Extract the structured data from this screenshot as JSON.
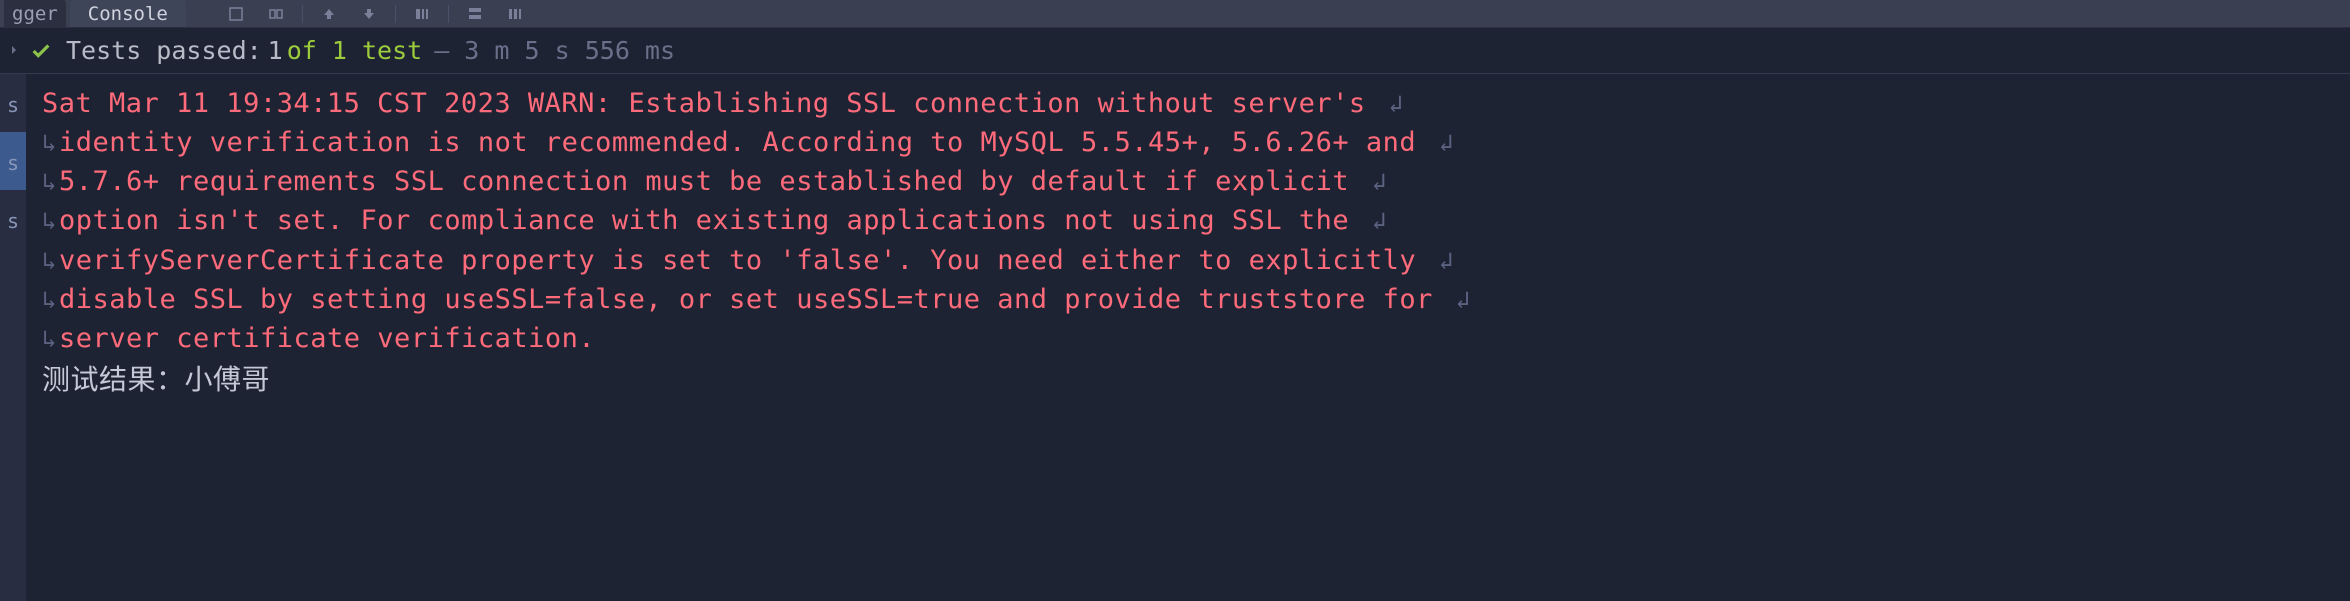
{
  "toolbar": {
    "tab_fragment": "gger",
    "active_tab": "Console"
  },
  "status": {
    "prefix_text": "Tests passed:",
    "counts_text": " 1 ",
    "of_text": "of 1 test",
    "duration_text": "– 3 m 5 s 556 ms"
  },
  "gutter": {
    "items": [
      "s",
      "s",
      "s"
    ]
  },
  "console": {
    "warn_lines": [
      "Sat Mar 11 19:34:15 CST 2023 WARN: Establishing SSL connection without server's ",
      "identity verification is not recommended. According to MySQL 5.5.45+, 5.6.26+ and ",
      "5.7.6+ requirements SSL connection must be established by default if explicit ",
      "option isn't set. For compliance with existing applications not using SSL the ",
      "verifyServerCertificate property is set to 'false'. You need either to explicitly ",
      "disable SSL by setting useSSL=false, or set useSSL=true and provide truststore for ",
      "server certificate verification."
    ],
    "result_text": "测试结果：小傅哥"
  }
}
